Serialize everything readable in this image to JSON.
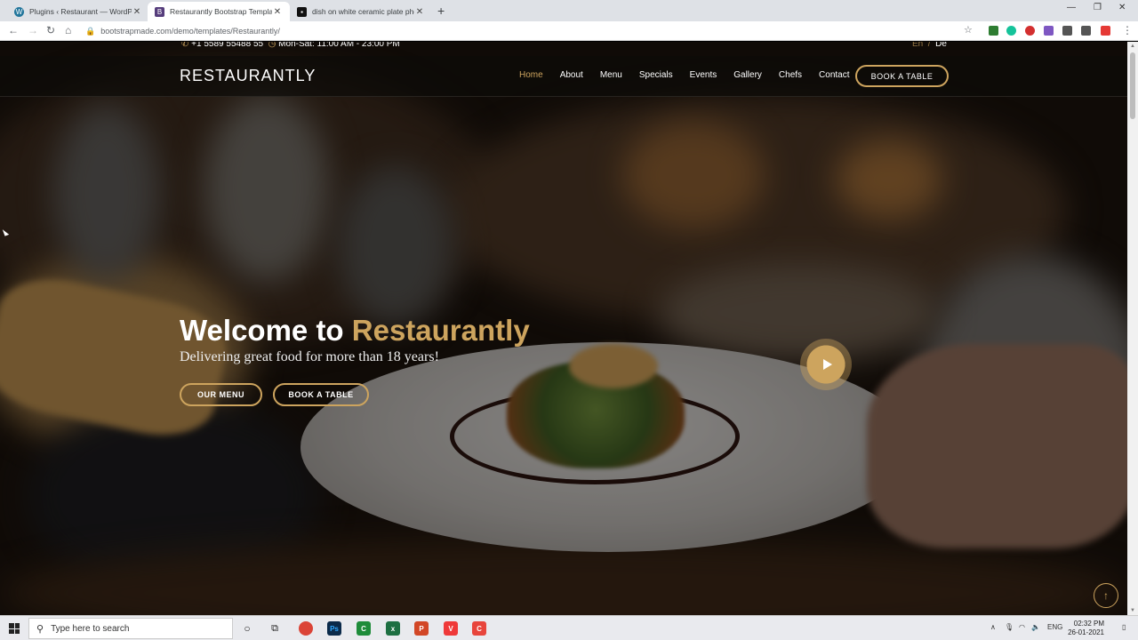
{
  "browser": {
    "tabs": [
      {
        "label": "Plugins ‹ Restaurant — WordPress",
        "icon": "wordpress-icon",
        "active": false
      },
      {
        "label": "Restaurantly Bootstrap Template",
        "icon": "bootstrap-icon",
        "active": true
      },
      {
        "label": "dish on white ceramic plate photo",
        "icon": "unsplash-icon",
        "active": false
      }
    ],
    "url": "bootstrapmade.com/demo/templates/Restaurantly/"
  },
  "topbar": {
    "phone": "+1 5589 55488 55",
    "hours": "Mon-Sat: 11:00 AM - 23:00 PM",
    "lang_en": "En",
    "lang_sep": "/",
    "lang_de": "De"
  },
  "header": {
    "logo": "RESTAURANTLY",
    "nav": [
      "Home",
      "About",
      "Menu",
      "Specials",
      "Events",
      "Gallery",
      "Chefs",
      "Contact"
    ],
    "active_nav": "Home",
    "book_button": "BOOK A TABLE"
  },
  "hero": {
    "title_prefix": "Welcome to",
    "title_brand": "Restaurantly",
    "subtitle": "Delivering great food for more than 18 years!",
    "btn_menu": "OUR MENU",
    "btn_book": "BOOK A TABLE"
  },
  "taskbar": {
    "search_placeholder": "Type here to search",
    "lang": "ENG",
    "time": "02:32 PM",
    "date": "26-01-2021"
  },
  "colors": {
    "accent": "#cda45e",
    "header_bg": "#0c0b09"
  }
}
